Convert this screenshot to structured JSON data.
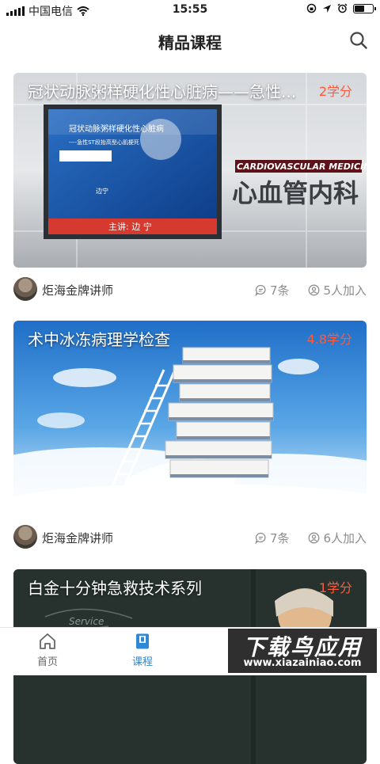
{
  "status_bar": {
    "carrier": "中国电信",
    "time": "15:55",
    "battery_level": 0.5
  },
  "header": {
    "title": "精品课程",
    "search_icon": "search-icon"
  },
  "courses": [
    {
      "title": "冠状动脉粥样硬化性心脏病——急性...",
      "credit": "2学分",
      "teacher": "炬海金牌讲师",
      "comments": "7条",
      "members": "5人加入",
      "cover": {
        "slide_title": "冠状动脉粥样硬化性心脏病",
        "slide_subtitle": "----急性ST段抬高型心肌梗死",
        "slide_author": "边宁",
        "slide_speaker": "主讲: 边 宁",
        "banner_en": "CARDIOVASCULAR MEDICINE",
        "banner_cn": "心血管内科"
      }
    },
    {
      "title": "术中冰冻病理学检查",
      "credit": "4.8学分",
      "teacher": "炬海金牌讲师",
      "comments": "7条",
      "members": "6人加入"
    },
    {
      "title": "白金十分钟急救技术系列",
      "credit": "1学分",
      "cover": {
        "chalk_text": "Service"
      }
    }
  ],
  "tabs": [
    {
      "label": "首页",
      "icon": "home-icon",
      "active": false
    },
    {
      "label": "课程",
      "icon": "book-icon",
      "active": true
    }
  ],
  "watermark": {
    "main": "下载鸟应用",
    "sub": "www.xiazainiao.com"
  },
  "colors": {
    "accent": "#2f88d6",
    "credit": "#ff5a3c",
    "meta_text": "#8c8c8c"
  }
}
